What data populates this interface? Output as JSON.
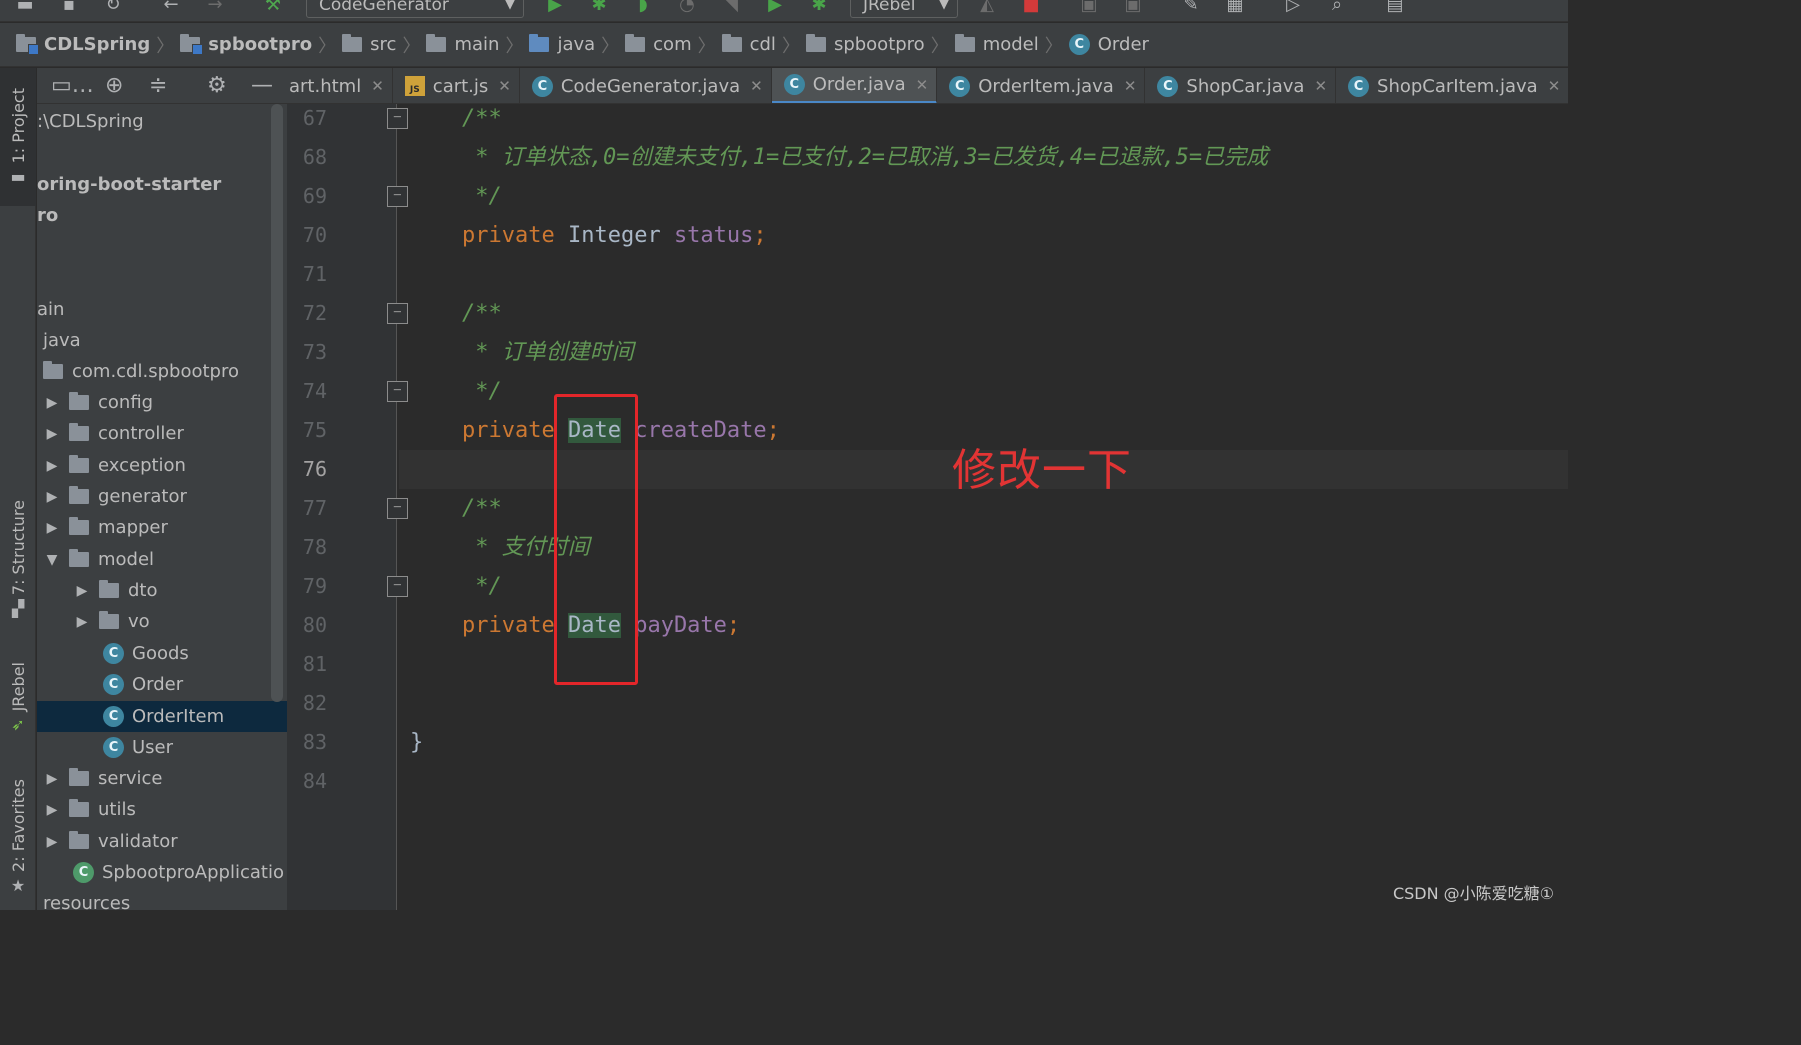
{
  "toolbar": {
    "run_config": "CodeGenerator",
    "jrebel_config": "JRebel"
  },
  "breadcrumb": [
    "CDLSpring",
    "spbootpro",
    "src",
    "main",
    "java",
    "com",
    "cdl",
    "spbootpro",
    "model",
    "Order"
  ],
  "sidebar": {
    "project_tab": "1: Project",
    "structure_tab": "7: Structure",
    "jrebel_tab": "JRebel",
    "favorites_tab": "2: Favorites"
  },
  "project_tree": [
    {
      "label": ":\\CDLSpring"
    },
    {
      "label": "oring-boot-starter"
    },
    {
      "label": "ro"
    },
    {
      "label": "ain"
    },
    {
      "label": "java"
    },
    {
      "label": "com.cdl.spbootpro"
    },
    {
      "label": "config"
    },
    {
      "label": "controller"
    },
    {
      "label": "exception"
    },
    {
      "label": "generator"
    },
    {
      "label": "mapper"
    },
    {
      "label": "model"
    },
    {
      "label": "dto"
    },
    {
      "label": "vo"
    },
    {
      "label": "Goods"
    },
    {
      "label": "Order"
    },
    {
      "label": "OrderItem"
    },
    {
      "label": "User"
    },
    {
      "label": "service"
    },
    {
      "label": "utils"
    },
    {
      "label": "validator"
    },
    {
      "label": "SpbootproApplicatio"
    },
    {
      "label": "resources"
    }
  ],
  "tabs": [
    {
      "label": "art.html"
    },
    {
      "label": "cart.js",
      "icon_text": "JS"
    },
    {
      "label": "CodeGenerator.java"
    },
    {
      "label": "Order.java"
    },
    {
      "label": "OrderItem.java"
    },
    {
      "label": "ShopCar.java"
    },
    {
      "label": "ShopCarItem.java"
    }
  ],
  "editor": {
    "line_numbers": [
      "67",
      "68",
      "69",
      "70",
      "71",
      "72",
      "73",
      "74",
      "75",
      "76",
      "77",
      "78",
      "79",
      "80",
      "81",
      "82",
      "83",
      "84"
    ],
    "current_line": "76",
    "code": {
      "l67": "/**",
      "l68": " * 订单状态,0=创建未支付,1=已支付,2=已取消,3=已发货,4=已退款,5=已完成",
      "l69": " */",
      "l70_kw": "private",
      "l70_type": "Integer",
      "l70_field": "status",
      "semicolon": ";",
      "l72": "/**",
      "l73": " * 订单创建时间",
      "l74": " */",
      "l75_kw": "private",
      "l75_type": "Date",
      "l75_field": "createDate",
      "l77": "/**",
      "l78": " * 支付时间",
      "l79": " */",
      "l80_kw": "private",
      "l80_type": "Date",
      "l80_field": "payDate",
      "l83": "}"
    }
  },
  "annotation": "修改一下",
  "watermark": "CSDN @小陈爱吃糖①",
  "icon_text": {
    "class_icon": "C"
  }
}
